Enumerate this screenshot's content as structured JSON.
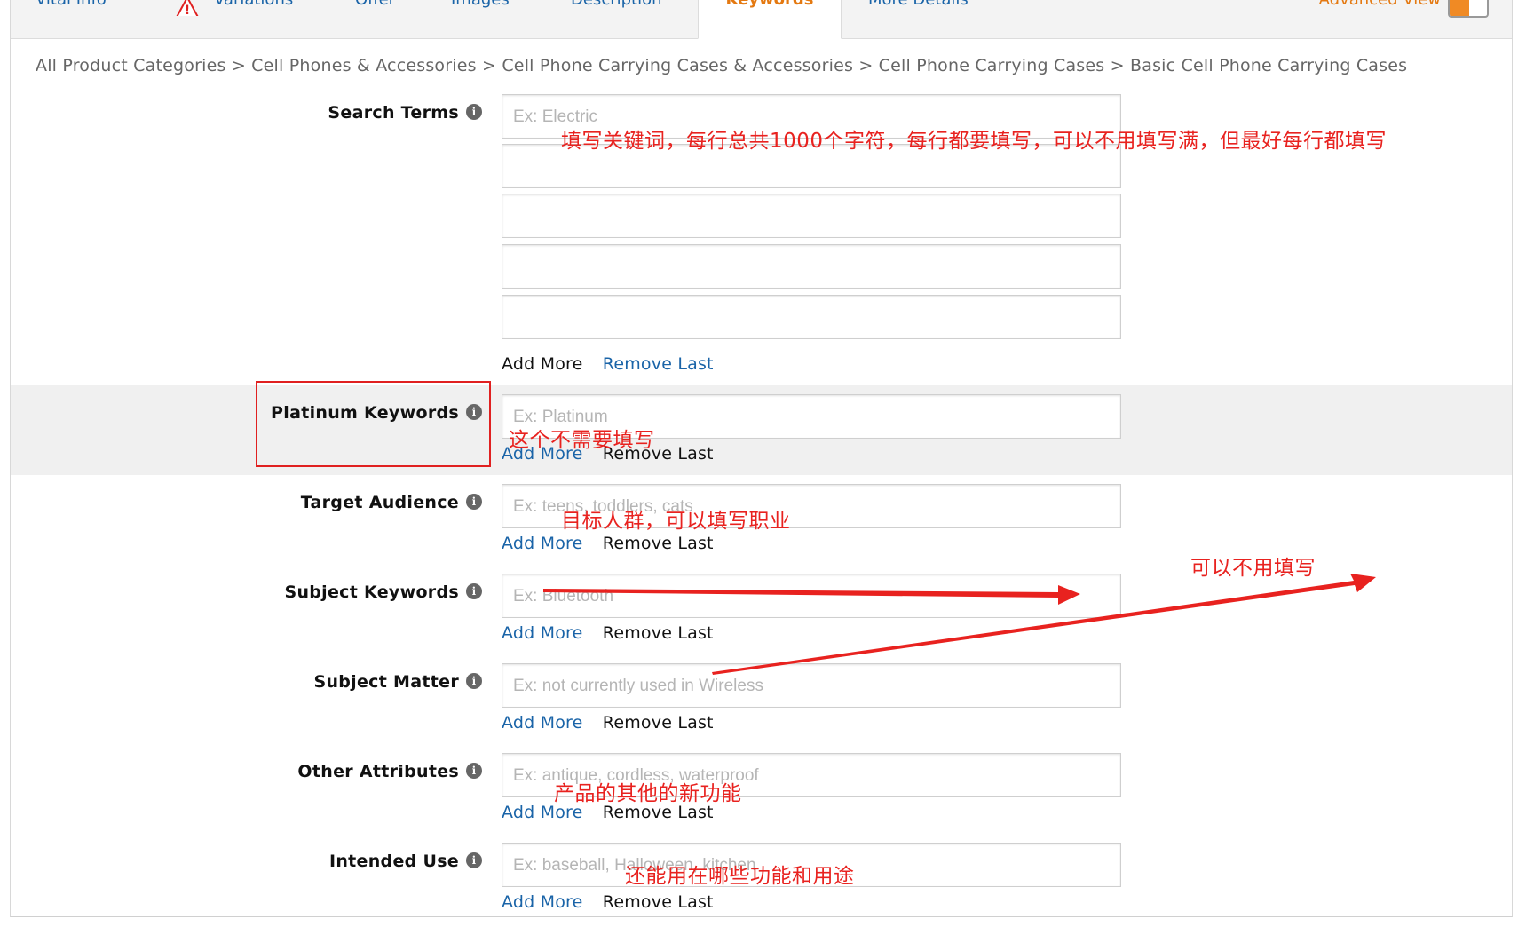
{
  "tabs": [
    {
      "label": "Vital Info",
      "active": false
    },
    {
      "label": "Variations",
      "active": false,
      "warning": true
    },
    {
      "label": "Offer",
      "active": false
    },
    {
      "label": "Images",
      "active": false
    },
    {
      "label": "Description",
      "active": false
    },
    {
      "label": "Keywords",
      "active": true
    },
    {
      "label": "More Details",
      "active": false
    }
  ],
  "advanced_view": {
    "label": "Advanced View",
    "toggle": "on"
  },
  "breadcrumb": "All Product Categories > Cell Phones & Accessories > Cell Phone Carrying Cases & Accessories > Cell Phone Carrying Cases > Basic Cell Phone Carrying Cases",
  "colors": {
    "accent": "#e47911",
    "link": "#1a64a8",
    "annotation": "#e8221f",
    "shaded_row": "#f0f0f0"
  },
  "fields": {
    "search_terms": {
      "label": "Search Terms",
      "inputs": [
        {
          "placeholder": "Ex: Electric",
          "value": ""
        },
        {
          "placeholder": "",
          "value": ""
        },
        {
          "placeholder": "",
          "value": ""
        },
        {
          "placeholder": "",
          "value": ""
        },
        {
          "placeholder": "",
          "value": ""
        }
      ],
      "add_more": "Add More",
      "remove_last": "Remove Last"
    },
    "platinum_keywords": {
      "label": "Platinum Keywords",
      "placeholder": "Ex: Platinum",
      "add_more": "Add More",
      "remove_last": "Remove Last"
    },
    "target_audience": {
      "label": "Target Audience",
      "placeholder": "Ex: teens, toddlers, cats",
      "add_more": "Add More",
      "remove_last": "Remove Last"
    },
    "subject_keywords": {
      "label": "Subject Keywords",
      "placeholder": "Ex: Bluetooth",
      "add_more": "Add More",
      "remove_last": "Remove Last"
    },
    "subject_matter": {
      "label": "Subject Matter",
      "placeholder": "Ex: not currently used in Wireless",
      "add_more": "Add More",
      "remove_last": "Remove Last"
    },
    "other_attributes": {
      "label": "Other Attributes",
      "placeholder": "Ex: antique, cordless, waterproof",
      "add_more": "Add More",
      "remove_last": "Remove Last"
    },
    "intended_use": {
      "label": "Intended Use",
      "placeholder": "Ex: baseball, Halloween, kitchen",
      "add_more": "Add More",
      "remove_last": "Remove Last"
    }
  },
  "annotations": {
    "search_terms": "填写关键词，每行总共1000个字符，每行都要填写，可以不用填写满，但最好每行都填写",
    "platinum": "这个不需要填写",
    "target_audience": "目标人群，可以填写职业",
    "optional": "可以不用填写",
    "other_attributes": "产品的其他的新功能",
    "intended_use": "还能用在哪些功能和用途"
  }
}
